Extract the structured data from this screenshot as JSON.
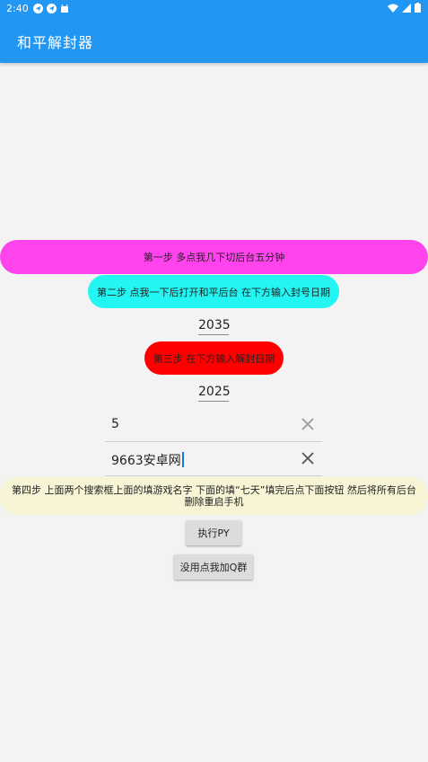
{
  "status_bar": {
    "time": "2:40",
    "left_icons": [
      "telegram-icon",
      "telegram-icon",
      "android-icon"
    ],
    "right_icons": [
      "wifi-icon",
      "signal-icon",
      "battery-icon"
    ]
  },
  "app_bar": {
    "title": "和平解封器"
  },
  "steps": {
    "step1": "第一步  多点我几下切后台五分钟",
    "step2": "第二步 点我一下后打开和平后台 在下方输入封号日期",
    "step3": "第三步 在下方输入解封日期",
    "step4": "第四步 上面两个搜索框上面的填游戏名字 下面的填“七天”填完后点下面按钮 然后将所有后台删除重启手机"
  },
  "dates": {
    "ban_date": "2035",
    "unban_date": "2025"
  },
  "fields": {
    "field1_value": "5",
    "field2_value": "9663安卓网"
  },
  "buttons": {
    "run": "执行PY",
    "join_qq": "没用点我加Q群"
  },
  "colors": {
    "primary": "#2196f3",
    "step1_bg": "#ff44ee",
    "step2_bg": "#22f5f2",
    "step3_bg": "#ff0000",
    "step4_bg": "#f7f5d6"
  }
}
